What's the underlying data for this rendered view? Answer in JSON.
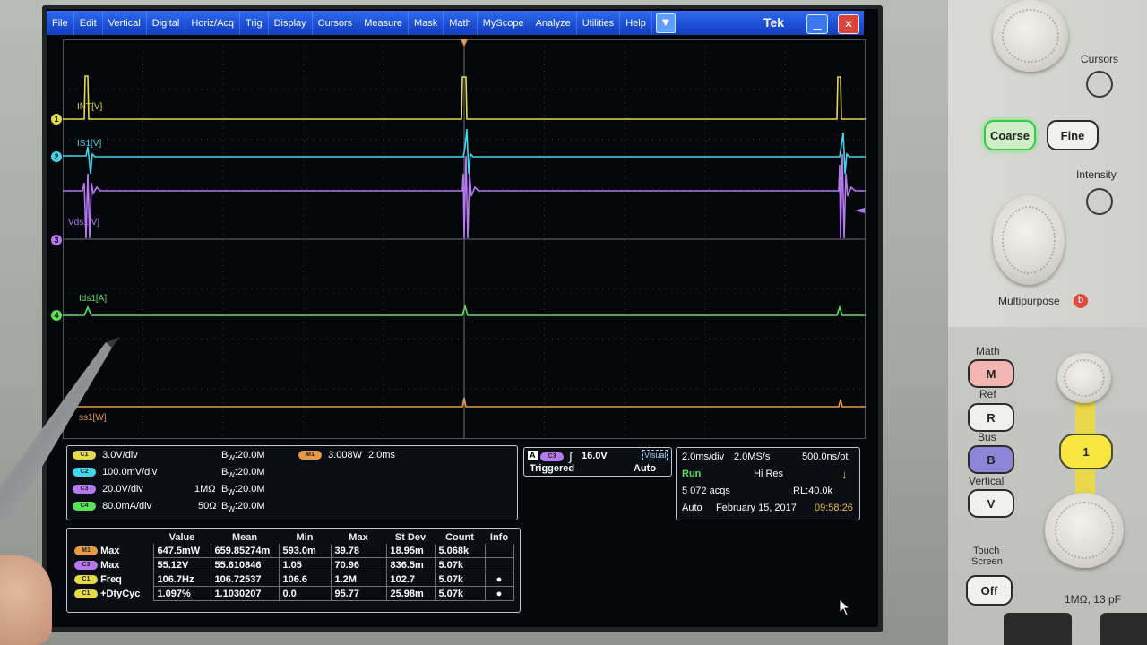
{
  "menu": {
    "items": [
      "File",
      "Edit",
      "Vertical",
      "Digital",
      "Horiz/Acq",
      "Trig",
      "Display",
      "Cursors",
      "Measure",
      "Mask",
      "Math",
      "MyScope",
      "Analyze",
      "Utilities",
      "Help"
    ],
    "dropdown_glyph": "▼",
    "brand": "Tek",
    "minimize_glyph": "▁",
    "close_glyph": "✕"
  },
  "channels": {
    "ch1": {
      "marker": "1",
      "label": "INT[V]",
      "color": "#e6d94a"
    },
    "ch2": {
      "marker": "2",
      "label": "IS1[V]",
      "color": "#3fd8ee"
    },
    "ch3": {
      "marker": "3",
      "label": "Vds1[V]",
      "color": "#b57af0"
    },
    "ch4": {
      "marker": "4",
      "label": "Ids1[A]",
      "color": "#5ce05a"
    },
    "math": {
      "label": "ss1[W]",
      "color": "#e99a45"
    }
  },
  "vertical_readout": {
    "rows": [
      {
        "badge": "C1",
        "color": "#e6d94a",
        "scale": "3.0V/div",
        "term": "",
        "bw": "20.0M"
      },
      {
        "badge": "C2",
        "color": "#3fd8ee",
        "scale": "100.0mV/div",
        "term": "",
        "bw": "20.0M"
      },
      {
        "badge": "C3",
        "color": "#b57af0",
        "scale": "20.0V/div",
        "term": "1MΩ",
        "bw": "20.0M"
      },
      {
        "badge": "C4",
        "color": "#5ce05a",
        "scale": "80.0mA/div",
        "term": "50Ω",
        "bw": "20.0M"
      }
    ],
    "bw_prefix": "B",
    "bw_sub": "W",
    "math": {
      "badge": "M1",
      "color": "#e99a45",
      "scale": "3.008W",
      "time": "2.0ms"
    }
  },
  "trigger": {
    "mode_badge": "A",
    "source_badge": "C3",
    "level": "16.0V",
    "visual": "Visual",
    "state": "Triggered",
    "mode": "Auto"
  },
  "acquisition": {
    "timebase": "2.0ms/div",
    "rate": "2.0MS/s",
    "resolution": "500.0ns/pt",
    "run_state": "Run",
    "acq_mode": "Hi Res",
    "acqs": "5 072 acqs",
    "record_length": "RL:40.0k",
    "trigger_mode": "Auto",
    "date": "February 15, 2017",
    "time": "09:58:26"
  },
  "measurements": {
    "headers": [
      "Value",
      "Mean",
      "Min",
      "Max",
      "St Dev",
      "Count",
      "Info"
    ],
    "rows": [
      {
        "badge": "M1",
        "color": "#e99a45",
        "name": "Max",
        "cells": [
          "647.5mW",
          "659.85274m",
          "593.0m",
          "39.78",
          "18.95m",
          "5.068k"
        ],
        "info": ""
      },
      {
        "badge": "C3",
        "color": "#b57af0",
        "name": "Max",
        "cells": [
          "55.12V",
          "55.610846",
          "1.05",
          "70.96",
          "836.5m",
          "5.07k"
        ],
        "info": ""
      },
      {
        "badge": "C1",
        "color": "#e6d94a",
        "name": "Freq",
        "cells": [
          "106.7Hz",
          "106.72537",
          "106.6",
          "1.2M",
          "102.7",
          "5.07k"
        ],
        "info": "●"
      },
      {
        "badge": "C1",
        "color": "#e6d94a",
        "name": "+DtyCyc",
        "cells": [
          "1.097%",
          "1.1030207",
          "0.0",
          "95.77",
          "25.98m",
          "5.07k"
        ],
        "info": "●"
      }
    ]
  },
  "panel": {
    "cursors_label": "Cursors",
    "coarse_label": "Coarse",
    "fine_label": "Fine",
    "intensity_label": "Intensity",
    "multipurpose_label": "Multipurpose",
    "multipurpose_badge": "b",
    "math_label": "Math",
    "math_btn": "M",
    "ref_label": "Ref",
    "ref_btn": "R",
    "bus_label": "Bus",
    "bus_btn": "B",
    "vertical_label": "Vertical",
    "vertical_btn": "V",
    "channel_btn": "1",
    "touch_label_1": "Touch",
    "touch_label_2": "Screen",
    "off_btn": "Off",
    "input_spec": "1MΩ, 13 pF"
  }
}
